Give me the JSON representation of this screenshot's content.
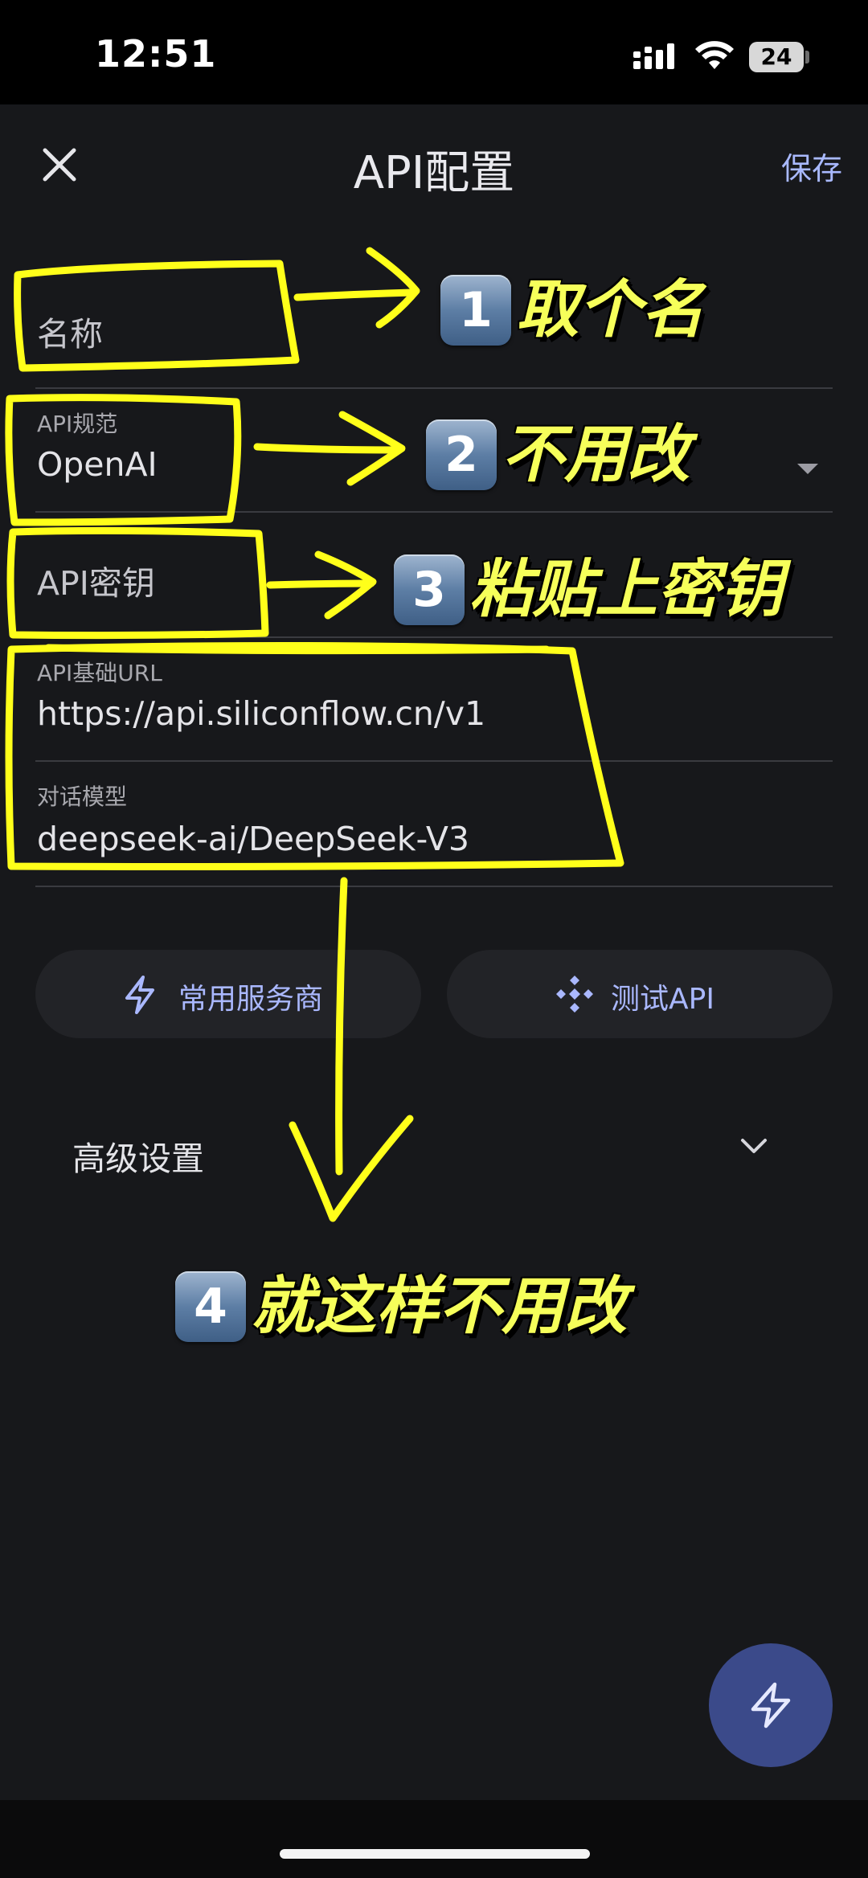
{
  "status_bar": {
    "time": "12:51",
    "battery": "24",
    "icons": [
      "signal-icon",
      "wifi-icon",
      "battery-icon"
    ]
  },
  "header": {
    "title": "API配置",
    "save_label": "保存",
    "close_icon": "close-icon"
  },
  "form": {
    "name": {
      "placeholder": "名称"
    },
    "api_spec": {
      "label": "API规范",
      "value": "OpenAI"
    },
    "api_key": {
      "placeholder": "API密钥"
    },
    "base_url": {
      "label": "API基础URL",
      "value": "https://api.siliconflow.cn/v1"
    },
    "chat_model": {
      "label": "对话模型",
      "value": "deepseek-ai/DeepSeek-V3"
    }
  },
  "buttons": {
    "providers_label": "常用服务商",
    "test_label": "测试API"
  },
  "advanced": {
    "label": "高级设置"
  },
  "annotations": [
    {
      "number": "1",
      "text": "取个名"
    },
    {
      "number": "2",
      "text": "不用改"
    },
    {
      "number": "3",
      "text": "粘贴上密钥"
    },
    {
      "number": "4",
      "text": "就这样不用改"
    }
  ],
  "colors": {
    "background": "#17181b",
    "accent": "#aab8ff",
    "fab": "#3b4a8a",
    "annotation_yellow": "#ffff1a"
  }
}
